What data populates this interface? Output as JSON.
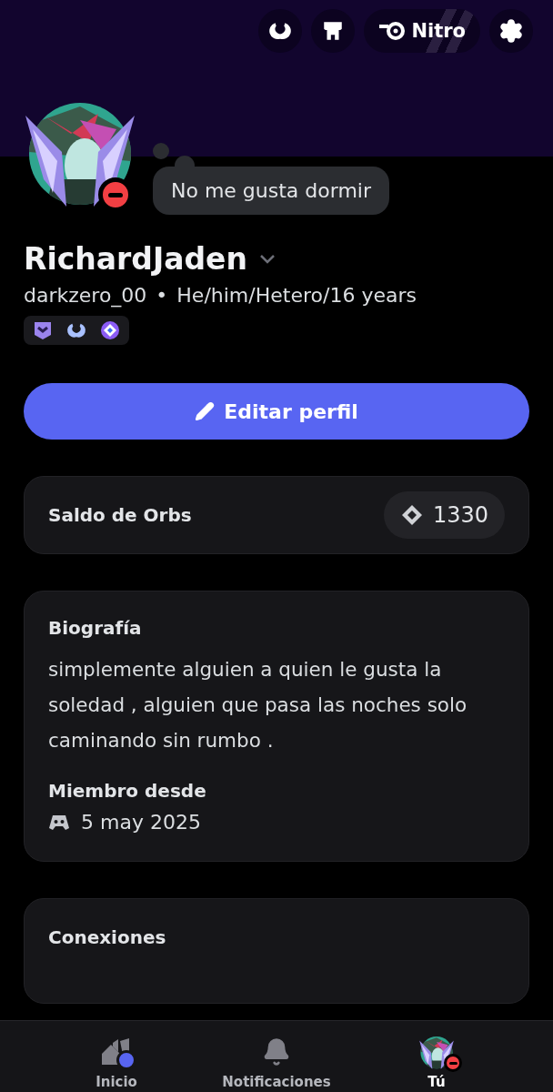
{
  "header_buttons": [
    {
      "kind": "quests"
    },
    {
      "kind": "shop"
    },
    {
      "kind": "nitro",
      "label": "Nitro"
    },
    {
      "kind": "settings"
    }
  ],
  "profile": {
    "do_not_disturb": true,
    "custom_status": "No me gusta dormir",
    "display_name": "RichardJaden",
    "username": "darkzero_00",
    "separator": "•",
    "pronouns": "He/him/Hetero/16 years",
    "badges": [
      {
        "kind": "hypesquad"
      },
      {
        "kind": "quest"
      },
      {
        "kind": "orb"
      }
    ]
  },
  "edit_button": "Editar perfil",
  "orbs": {
    "label": "Saldo de Orbs",
    "balance": "1330"
  },
  "bio": {
    "title": "Biografía",
    "text": "simplemente alguien a quien le gusta la soledad , alguien que pasa las noches solo caminando sin rumbo .",
    "member_title": "Miembro desde",
    "member_date": "5 may 2025"
  },
  "connections": {
    "title": "Conexiones"
  },
  "nav": [
    {
      "kind": "home",
      "label": "Inicio",
      "selected": false,
      "unread": true
    },
    {
      "kind": "notifications",
      "label": "Notificaciones",
      "selected": false,
      "unread": false
    },
    {
      "kind": "you",
      "label": "Tú",
      "selected": true,
      "unread": false
    }
  ]
}
